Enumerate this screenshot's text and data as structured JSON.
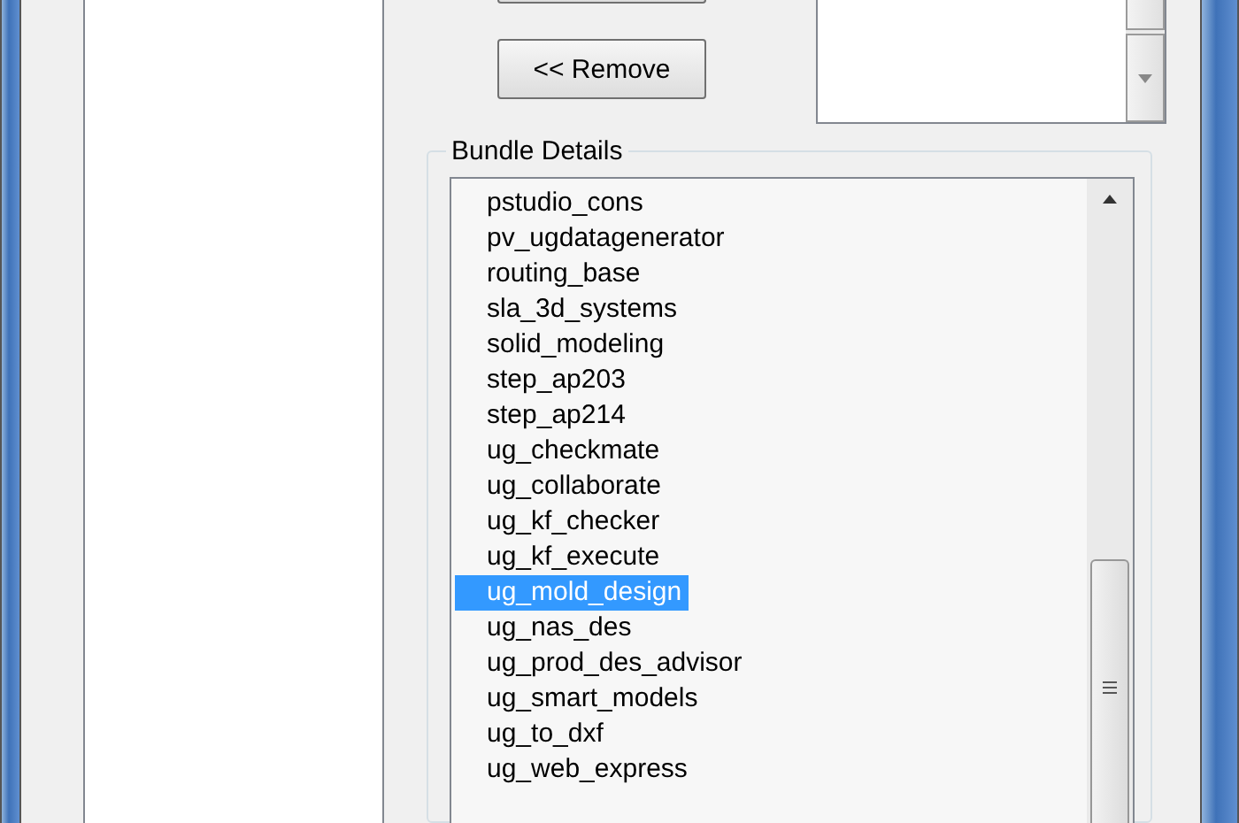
{
  "remove_button": "<< Remove",
  "bundle_details": {
    "title": "Bundle Details",
    "items": [
      {
        "label": "pstudio_cons",
        "selected": false
      },
      {
        "label": "pv_ugdatagenerator",
        "selected": false
      },
      {
        "label": "routing_base",
        "selected": false
      },
      {
        "label": "sla_3d_systems",
        "selected": false
      },
      {
        "label": "solid_modeling",
        "selected": false
      },
      {
        "label": "step_ap203",
        "selected": false
      },
      {
        "label": "step_ap214",
        "selected": false
      },
      {
        "label": "ug_checkmate",
        "selected": false
      },
      {
        "label": "ug_collaborate",
        "selected": false
      },
      {
        "label": "ug_kf_checker",
        "selected": false
      },
      {
        "label": "ug_kf_execute",
        "selected": false
      },
      {
        "label": "ug_mold_design",
        "selected": true
      },
      {
        "label": "ug_nas_des",
        "selected": false
      },
      {
        "label": "ug_prod_des_advisor",
        "selected": false
      },
      {
        "label": "ug_smart_models",
        "selected": false
      },
      {
        "label": "ug_to_dxf",
        "selected": false
      },
      {
        "label": "ug_web_express",
        "selected": false
      }
    ]
  }
}
